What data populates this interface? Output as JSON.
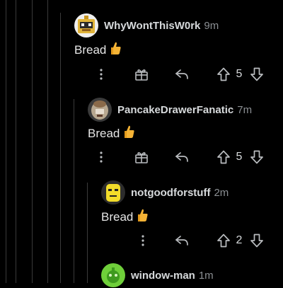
{
  "comments": [
    {
      "author": "WhyWontThisW0rk",
      "time": "9m",
      "text": "Bread",
      "votes": "5",
      "avatar": "robot-box-avatar"
    },
    {
      "author": "PancakeDrawerFanatic",
      "time": "7m",
      "text": "Bread",
      "votes": "5",
      "avatar": "pancake-avatar"
    },
    {
      "author": "notgoodforstuff",
      "time": "2m",
      "text": "Bread",
      "votes": "2",
      "avatar": "yellow-face-avatar"
    },
    {
      "author": "window-man",
      "time": "1m",
      "avatar": "green-blob-avatar"
    }
  ],
  "icons": {
    "more": "more-vertical-icon",
    "award": "gift-award-icon",
    "reply": "reply-arrow-icon",
    "upvote": "upvote-arrow-icon",
    "downvote": "downvote-arrow-icon",
    "emoji": "thumbs-up-emoji"
  },
  "colors": {
    "background": "#000000",
    "thread_line": "#3a3a3a",
    "text": "#d7dadc",
    "muted": "#8b8f93"
  }
}
